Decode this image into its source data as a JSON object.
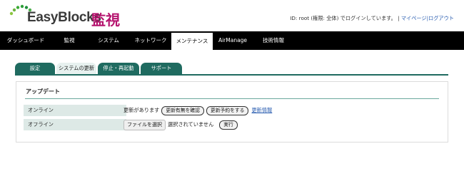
{
  "header": {
    "logo_text": "EasyBlocks",
    "logo_subtitle": "監視",
    "login_text": "ID: root (権限: 全体) でログインしています。 |",
    "mypage_link": "マイページ",
    "separator": "|",
    "logout_link": "ログアウト"
  },
  "nav": {
    "items": [
      {
        "label": "ダッシュボード"
      },
      {
        "label": "監視"
      },
      {
        "label": "システム"
      },
      {
        "label": "ネットワーク"
      },
      {
        "label": "メンテナンス",
        "active": true
      },
      {
        "label": "AirManage"
      },
      {
        "label": "技術情報"
      }
    ]
  },
  "subtabs": {
    "items": [
      {
        "label": "設定"
      },
      {
        "label": "システムの更新",
        "active": true
      },
      {
        "label": "停止・再起動"
      },
      {
        "label": "サポート"
      }
    ]
  },
  "panel": {
    "title": "アップデート",
    "online": {
      "label": "オンライン",
      "status": "更新があります",
      "check_button": "更新有無を確認",
      "schedule_button": "更新予約をする",
      "info_link": "更新情報"
    },
    "offline": {
      "label": "オフライン",
      "file_button": "ファイルを選択",
      "file_status": "選択されていません",
      "run_button": "実行"
    }
  },
  "colors": {
    "accent": "#1f6b60",
    "brand_subtitle": "#b5136e",
    "row_label_bg": "#dde9e6",
    "link": "#2a5db0"
  },
  "icons": {
    "logo": "easyblocks-dots-logo-icon"
  }
}
